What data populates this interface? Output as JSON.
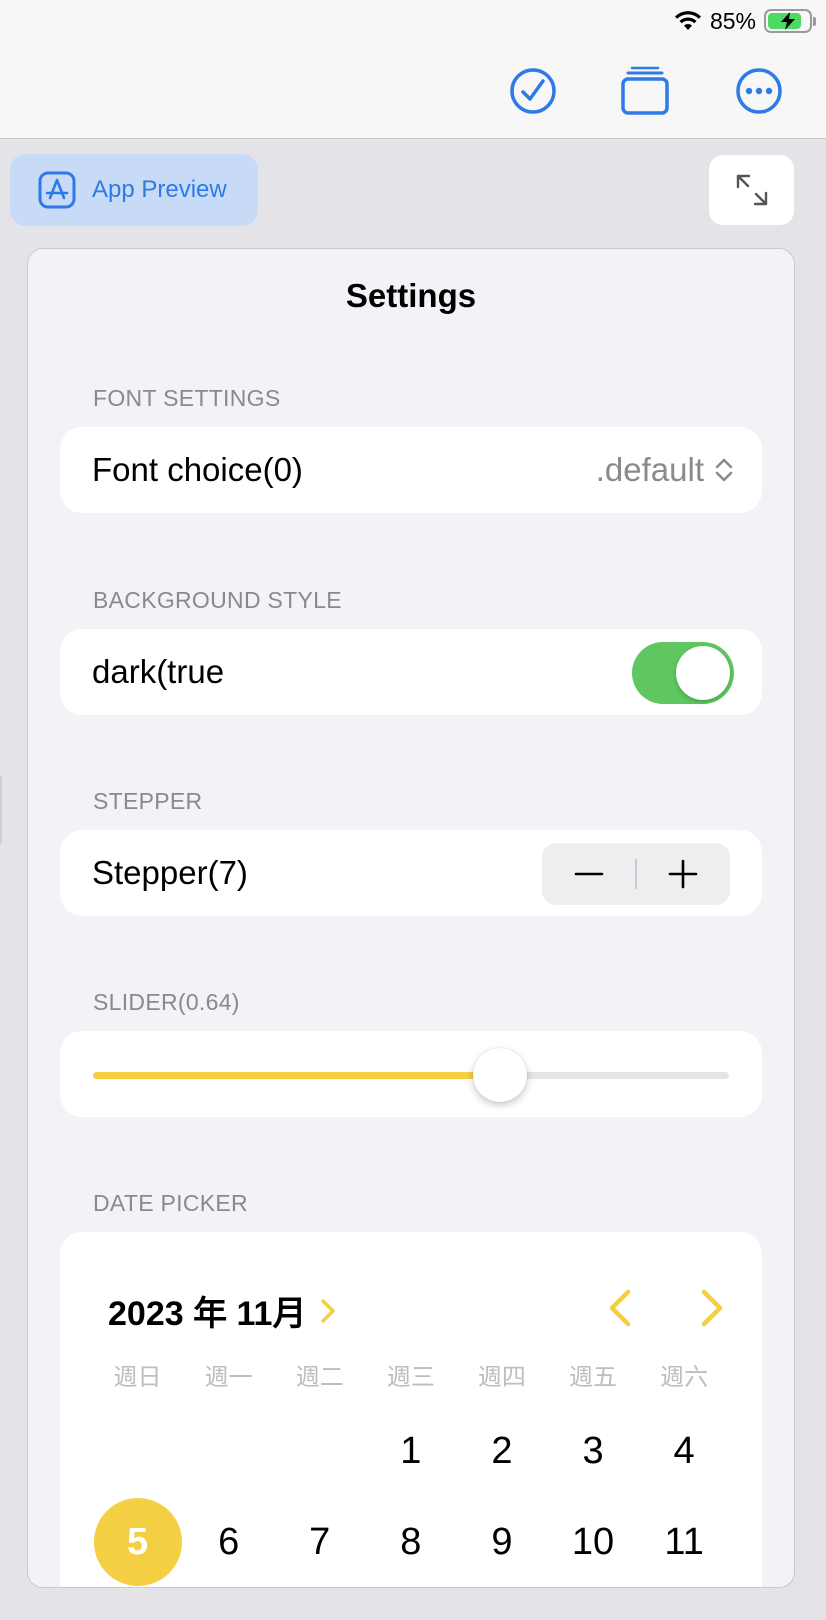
{
  "status_bar": {
    "battery_text": "85%",
    "battery_level": 0.85
  },
  "toolbar": {
    "icons": [
      "checkmark-circle-icon",
      "stack-icon",
      "more-circle-icon"
    ]
  },
  "app_preview": {
    "label": "App Preview",
    "icon": "app-store-icon"
  },
  "expand_icon": "expand-arrows-icon",
  "settings": {
    "title": "Settings",
    "font": {
      "header": "FONT SETTINGS",
      "label": "Font choice(0)",
      "value": ".default"
    },
    "background": {
      "header": "BACKGROUND STYLE",
      "label": "dark(true",
      "toggle_on": true
    },
    "stepper": {
      "header": "STEPPER",
      "label": "Stepper(7)",
      "minus": "−",
      "plus": "+"
    },
    "slider": {
      "header": "SLIDER(0.64)",
      "value": 0.64
    },
    "date_picker": {
      "header": "DATE PICKER",
      "month_label": "2023 年 11月",
      "weekdays": [
        "週日",
        "週一",
        "週二",
        "週三",
        "週四",
        "週五",
        "週六"
      ],
      "weeks": [
        [
          "",
          "",
          "",
          "1",
          "2",
          "3",
          "4"
        ],
        [
          "5",
          "6",
          "7",
          "8",
          "9",
          "10",
          "11"
        ]
      ],
      "selected_day": "5"
    }
  },
  "colors": {
    "accent": "#2e7ae6",
    "toggle_on": "#5fc660",
    "calendar_accent": "#f4cf44"
  }
}
